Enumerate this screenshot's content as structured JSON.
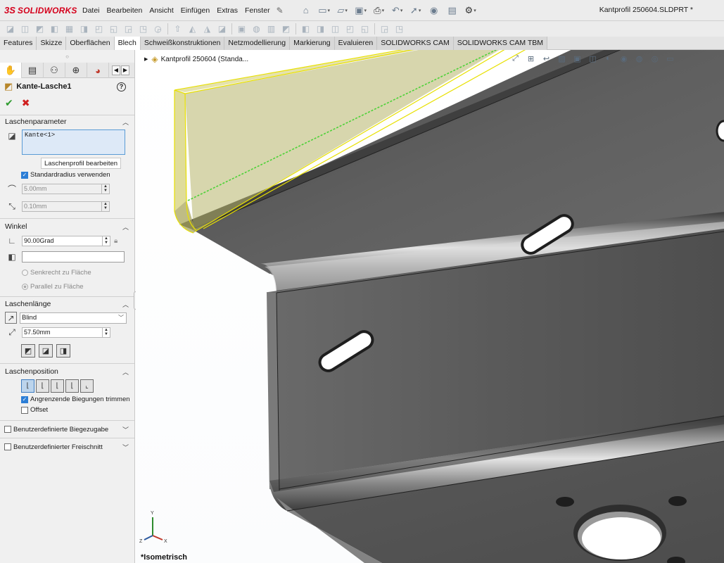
{
  "app": {
    "logo_prefix": "3S",
    "logo_text": "SOLIDWORKS",
    "document_title": "Kantprofil 250604.SLDPRT *"
  },
  "menu": {
    "items": [
      "Datei",
      "Bearbeiten",
      "Ansicht",
      "Einfügen",
      "Extras",
      "Fenster"
    ]
  },
  "tabs": [
    {
      "label": "Features"
    },
    {
      "label": "Skizze"
    },
    {
      "label": "Oberflächen"
    },
    {
      "label": "Blech"
    },
    {
      "label": "Schweißkonstruktionen"
    },
    {
      "label": "Netzmodellierung"
    },
    {
      "label": "Markierung"
    },
    {
      "label": "Evaluieren"
    },
    {
      "label": "SOLIDWORKS CAM"
    },
    {
      "label": "SOLIDWORKS CAM TBM"
    }
  ],
  "property_manager": {
    "feature_name": "Kante-Lasche1",
    "groups": {
      "parameters": {
        "title": "Laschenparameter",
        "edge_selection": "Kante<1>",
        "edit_profile_button": "Laschenprofil bearbeiten",
        "use_default_radius": {
          "label": "Standardradius verwenden",
          "checked": true
        },
        "radius": "5.00mm",
        "thickness": "0.10mm"
      },
      "angle": {
        "title": "Winkel",
        "angle_value": "90.00Grad",
        "reference_face": "",
        "option_perpendicular": "Senkrecht zu Fläche",
        "option_parallel": "Parallel zu Fläche"
      },
      "length": {
        "title": "Laschenlänge",
        "end_condition": "Blind",
        "length_value": "57.50mm"
      },
      "position": {
        "title": "Laschenposition",
        "trim_adjacent": {
          "label": "Angrenzende Biegungen trimmen",
          "checked": true
        },
        "offset": {
          "label": "Offset",
          "checked": false
        }
      },
      "custom_bend_allowance": "Benutzerdefinierte Biegezugabe",
      "custom_relief": "Benutzerdefinierter Freischnitt"
    }
  },
  "viewport": {
    "tree_crumb": "Kantprofil 250604 (Standa...",
    "view_label": "*Isometrisch"
  },
  "colors": {
    "brand_red": "#d5001c",
    "preview_yellow": "#e8e000",
    "preview_fill": "#b8b56a",
    "model_gray": "#5c5c5c",
    "highlight_blue": "#dde9f7"
  }
}
